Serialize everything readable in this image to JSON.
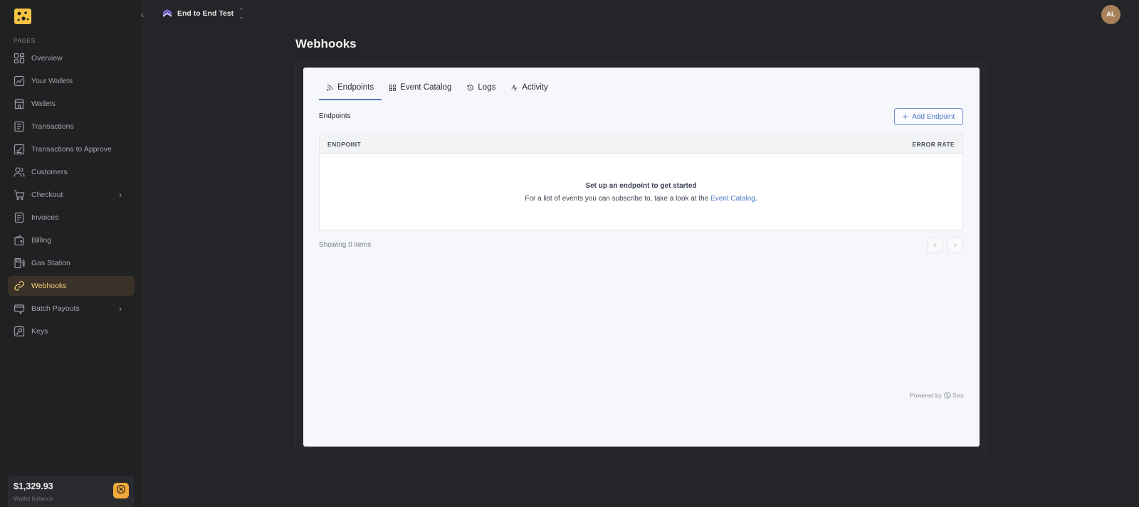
{
  "sidebar": {
    "section_label": "PAGES",
    "items": [
      {
        "label": "Overview",
        "icon": "grid-icon",
        "active": false
      },
      {
        "label": "Your Wallets",
        "icon": "chart-line-icon",
        "active": false
      },
      {
        "label": "Wallets",
        "icon": "store-icon",
        "active": false
      },
      {
        "label": "Transactions",
        "icon": "list-icon",
        "active": false
      },
      {
        "label": "Transactions to Approve",
        "icon": "approve-icon",
        "active": false
      },
      {
        "label": "Customers",
        "icon": "users-icon",
        "active": false
      },
      {
        "label": "Checkout",
        "icon": "cart-icon",
        "active": false,
        "has_children": true
      },
      {
        "label": "Invoices",
        "icon": "invoice-icon",
        "active": false
      },
      {
        "label": "Billing",
        "icon": "wallet-icon",
        "active": false
      },
      {
        "label": "Gas Station",
        "icon": "gas-pump-icon",
        "active": false
      },
      {
        "label": "Webhooks",
        "icon": "link-icon",
        "active": true
      },
      {
        "label": "Batch Payouts",
        "icon": "batch-icon",
        "active": false,
        "has_children": true
      },
      {
        "label": "Keys",
        "icon": "key-icon",
        "active": false
      }
    ],
    "wallet": {
      "amount": "$1,329.93",
      "label": "Wallet balance"
    }
  },
  "header": {
    "project_name": "End to End Test",
    "avatar_initials": "AL"
  },
  "main": {
    "title": "Webhooks",
    "tabs": [
      {
        "label": "Endpoints",
        "icon": "rss-icon",
        "active": true
      },
      {
        "label": "Event Catalog",
        "icon": "grid-icon",
        "active": false
      },
      {
        "label": "Logs",
        "icon": "history-icon",
        "active": false
      },
      {
        "label": "Activity",
        "icon": "activity-icon",
        "active": false
      }
    ],
    "section_heading": "Endpoints",
    "add_button": "Add Endpoint",
    "table": {
      "columns": [
        "ENDPOINT",
        "ERROR RATE"
      ],
      "empty_title": "Set up an endpoint to get started",
      "empty_text_before": "For a list of events you can subscribe to, take a look at the ",
      "empty_link": "Event Catalog",
      "empty_text_after": "."
    },
    "showing": "Showing 0 items",
    "powered_by": "Powered by",
    "powered_brand": "Svix"
  },
  "colors": {
    "accent": "#4e78c6",
    "active_nav_text": "#f4c976",
    "active_nav_bg": "#3a3128",
    "wallet_button": "#f0a93a"
  }
}
